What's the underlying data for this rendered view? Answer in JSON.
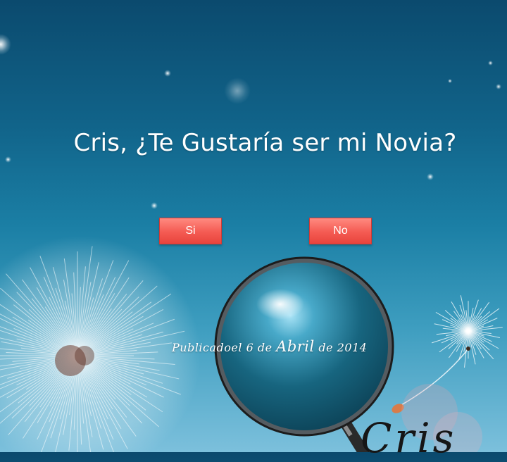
{
  "question": "Cris, ¿Te Gustaría ser mi Novia?",
  "buttons": {
    "yes_label": "Si",
    "no_label": "No"
  },
  "published": {
    "prefix": "Publicado",
    "connector": "el 6 de ",
    "month": "Abril",
    "suffix": " de 2014"
  },
  "signature": "Cris",
  "colors": {
    "sky_top": "#0b4a6e",
    "sky_bottom": "#7cc0dc",
    "button": "#f45a52",
    "text": "#ffffff"
  },
  "icons": [
    "magnifying-glass-icon",
    "dandelion-left",
    "dandelion-right"
  ]
}
